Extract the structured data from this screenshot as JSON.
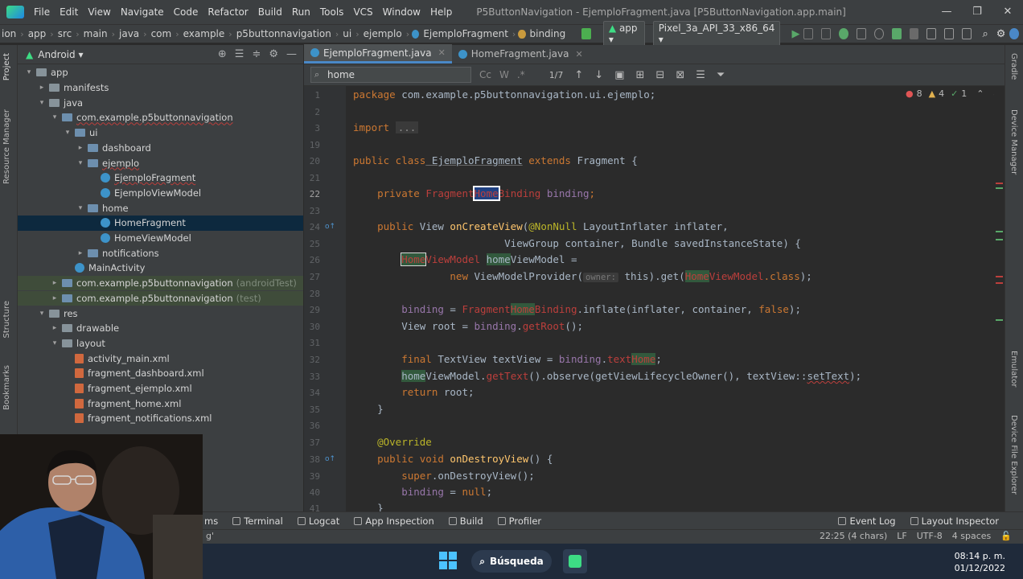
{
  "menubar": {
    "items": [
      "File",
      "Edit",
      "View",
      "Navigate",
      "Code",
      "Refactor",
      "Build",
      "Run",
      "Tools",
      "VCS",
      "Window",
      "Help"
    ],
    "title": "P5ButtonNavigation - EjemploFragment.java [P5ButtonNavigation.app.main]",
    "minimize": "—",
    "maximize": "❐",
    "close": "✕"
  },
  "navbar": {
    "crumbs": [
      "ion",
      "app",
      "src",
      "main",
      "java",
      "com",
      "example",
      "p5buttonnavigation",
      "ui",
      "ejemplo",
      "EjemploFragment",
      "binding"
    ],
    "config": "app ▾",
    "device": "Pixel_3a_API_33_x86_64 ▾"
  },
  "left_strip": {
    "project": "Project",
    "resource_manager": "Resource Manager",
    "structure": "Structure",
    "bookmarks": "Bookmarks"
  },
  "right_strip": {
    "gradle": "Gradle",
    "device_manager": "Device Manager",
    "emulator": "Emulator",
    "device_file_explorer": "Device File Explorer"
  },
  "project": {
    "selector": "Android ▾",
    "tree": [
      {
        "label": "app",
        "indent": 0,
        "arrow": "▾",
        "icon": "folder"
      },
      {
        "label": "manifests",
        "indent": 1,
        "arrow": "▸",
        "icon": "folder"
      },
      {
        "label": "java",
        "indent": 1,
        "arrow": "▾",
        "icon": "folder"
      },
      {
        "label": "com.example.p5buttonnavigation",
        "indent": 2,
        "arrow": "▾",
        "icon": "java",
        "error": true
      },
      {
        "label": "ui",
        "indent": 3,
        "arrow": "▾",
        "icon": "java"
      },
      {
        "label": "dashboard",
        "indent": 4,
        "arrow": "▸",
        "icon": "java"
      },
      {
        "label": "ejemplo",
        "indent": 4,
        "arrow": "▾",
        "icon": "java",
        "error": true
      },
      {
        "label": "EjemploFragment",
        "indent": 5,
        "arrow": "",
        "icon": "class",
        "error": true
      },
      {
        "label": "EjemploViewModel",
        "indent": 5,
        "arrow": "",
        "icon": "class"
      },
      {
        "label": "home",
        "indent": 4,
        "arrow": "▾",
        "icon": "java"
      },
      {
        "label": "HomeFragment",
        "indent": 5,
        "arrow": "",
        "icon": "class",
        "selected": true
      },
      {
        "label": "HomeViewModel",
        "indent": 5,
        "arrow": "",
        "icon": "class"
      },
      {
        "label": "notifications",
        "indent": 4,
        "arrow": "▸",
        "icon": "java"
      },
      {
        "label": "MainActivity",
        "indent": 3,
        "arrow": "",
        "icon": "class"
      },
      {
        "label": "com.example.p5buttonnavigation",
        "suffix": "(androidTest)",
        "indent": 2,
        "arrow": "▸",
        "icon": "java",
        "test": true
      },
      {
        "label": "com.example.p5buttonnavigation",
        "suffix": "(test)",
        "indent": 2,
        "arrow": "▸",
        "icon": "java",
        "test": true
      },
      {
        "label": "res",
        "indent": 1,
        "arrow": "▾",
        "icon": "folder"
      },
      {
        "label": "drawable",
        "indent": 2,
        "arrow": "▸",
        "icon": "folder"
      },
      {
        "label": "layout",
        "indent": 2,
        "arrow": "▾",
        "icon": "folder"
      },
      {
        "label": "activity_main.xml",
        "indent": 3,
        "arrow": "",
        "icon": "xml"
      },
      {
        "label": "fragment_dashboard.xml",
        "indent": 3,
        "arrow": "",
        "icon": "xml"
      },
      {
        "label": "fragment_ejemplo.xml",
        "indent": 3,
        "arrow": "",
        "icon": "xml"
      },
      {
        "label": "fragment_home.xml",
        "indent": 3,
        "arrow": "",
        "icon": "xml"
      },
      {
        "label": "fragment_notifications.xml",
        "indent": 3,
        "arrow": "",
        "icon": "xml"
      }
    ]
  },
  "tabs": [
    {
      "label": "EjemploFragment.java",
      "active": true
    },
    {
      "label": "HomeFragment.java",
      "active": false
    }
  ],
  "search": {
    "value": "home",
    "match_case": "Cc",
    "words": "W",
    "regex": ".*",
    "count": "1/7"
  },
  "inspection": {
    "errors": "8",
    "warnings": "4",
    "ok": "1"
  },
  "editor": {
    "line_numbers": [
      "1",
      "2",
      "3",
      "19",
      "20",
      "21",
      "22",
      "23",
      "24",
      "25",
      "26",
      "27",
      "28",
      "29",
      "30",
      "31",
      "32",
      "33",
      "34",
      "35",
      "36",
      "37",
      "38",
      "39",
      "40",
      "41"
    ],
    "lines": {
      "l1_kw": "package",
      "l1_rest": " com.example.p5buttonnavigation.ui.ejemplo;",
      "l3_kw": "import",
      "l3_fold": "...",
      "l20_kw": "public class",
      "l20_cls": " EjemploFragment",
      "l20_kw2": " extends",
      "l20_rest": " Fragment {",
      "l22_kw": "    private",
      "l22_a": " Fragment",
      "l22_b": "Home",
      "l22_c": "Binding",
      "l22_fld": " binding",
      "l22_end": ";",
      "l24_kw": "    public",
      "l24_type": " View ",
      "l24_fn": "onCreateView",
      "l24_paren": "(",
      "l24_ann": "@NonNull",
      "l24_rest": " LayoutInflater inflater,",
      "l25": "                         ViewGroup container, Bundle savedInstanceState) {",
      "l26_pad": "        ",
      "l26_a": "Home",
      "l26_b": "ViewModel",
      "l26_sp": " ",
      "l26_c": "home",
      "l26_d": "ViewModel =",
      "l27_kw": "                new",
      "l27_a": " ViewModelProvider(",
      "l27_hint": "owner:",
      "l27_b": " this).get(",
      "l27_c": "Home",
      "l27_d": "ViewModel",
      "l27_e": ".class",
      "l27_f": ");",
      "l29_pad": "        ",
      "l29_fld": "binding",
      "l29_a": " = ",
      "l29_b": "Fragment",
      "l29_c": "Home",
      "l29_d": "Binding",
      "l29_e": ".inflate(inflater, container, ",
      "l29_kw": "false",
      "l29_f": ");",
      "l30_a": "        View root = ",
      "l30_fld": "binding",
      "l30_b": ".",
      "l30_fn": "getRoot",
      "l30_c": "();",
      "l32_kw": "        final",
      "l32_a": " TextView textView = ",
      "l32_fld": "binding",
      "l32_b": ".",
      "l32_c": "text",
      "l32_d": "Home",
      "l32_e": ";",
      "l33_pad": "        ",
      "l33_a": "home",
      "l33_b": "ViewModel.",
      "l33_c": "getText",
      "l33_d": "().observe(getViewLifecycleOwner(), textView::",
      "l33_e": "setText",
      "l33_f": ");",
      "l34_kw": "        return",
      "l34_rest": " root;",
      "l35": "    }",
      "l37_ann": "    @Override",
      "l38_kw": "    public void",
      "l38_fn": " onDestroyView",
      "l38_rest": "() {",
      "l39_kw": "        super",
      "l39_rest": ".onDestroyView();",
      "l40_pad": "        ",
      "l40_fld": "binding",
      "l40_a": " = ",
      "l40_kw": "null",
      "l40_b": ";",
      "l41": "    }"
    }
  },
  "bottom_tools": [
    "ms",
    "Terminal",
    "Logcat",
    "App Inspection",
    "Build",
    "Profiler"
  ],
  "bottom_tools_right": [
    "Event Log",
    "Layout Inspector"
  ],
  "status": {
    "left": "g'",
    "position": "22:25 (4 chars)",
    "line_sep": "LF",
    "encoding": "UTF-8",
    "indent": "4 spaces"
  },
  "taskbar": {
    "search_label": "Búsqueda",
    "time": "08:14 p. m.",
    "date": "01/12/2022"
  },
  "colors": {
    "accent": "#4a88c7",
    "editor_bg": "#2b2b2b",
    "panel_bg": "#3c3f41",
    "keyword": "#cc7832",
    "error": "#bc3f3c",
    "match_highlight": "#32593d"
  }
}
